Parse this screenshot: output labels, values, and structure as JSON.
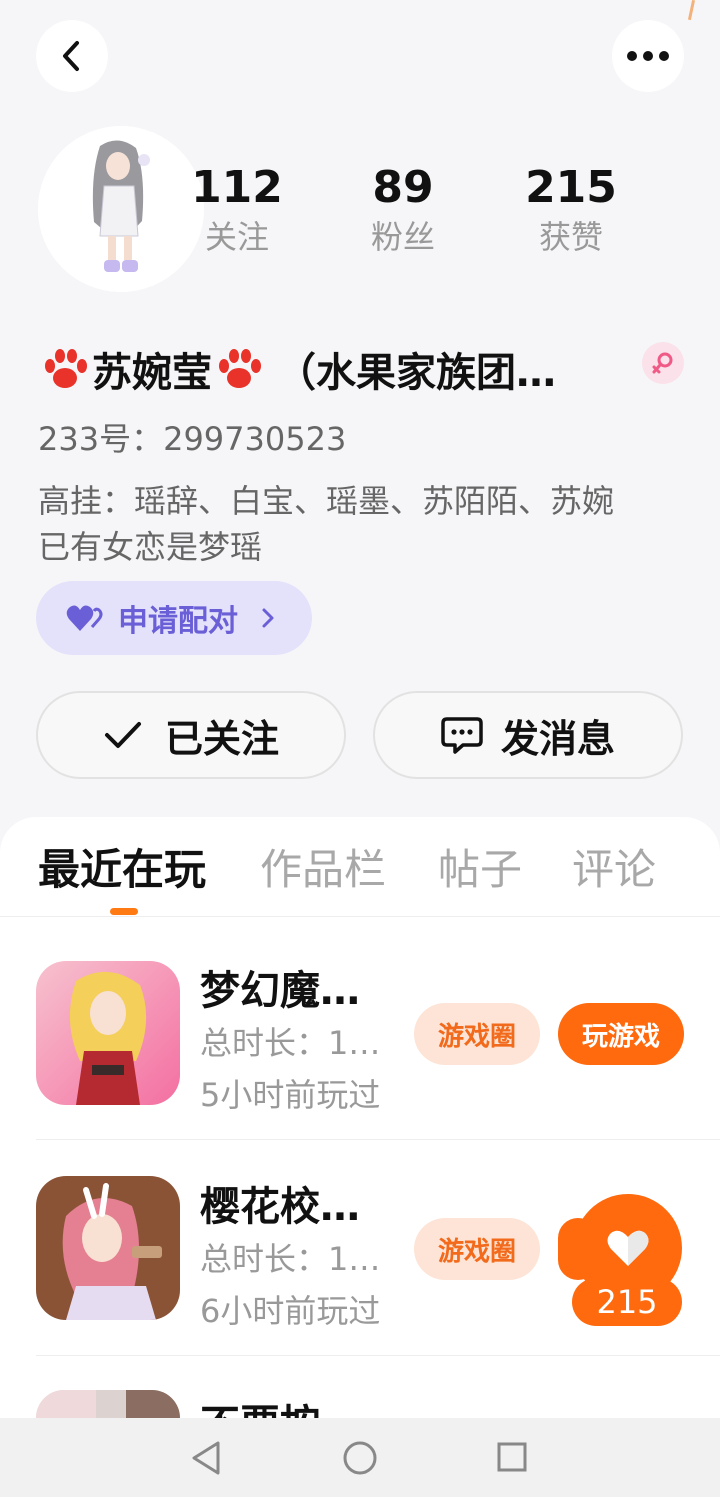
{
  "header": {
    "back_icon": "chevron-left-icon",
    "more_icon": "more-dots-icon"
  },
  "profile": {
    "stats": [
      {
        "value": "112",
        "label": "关注"
      },
      {
        "value": "89",
        "label": "粉丝"
      },
      {
        "value": "215",
        "label": "获赞"
      }
    ],
    "name": "苏婉莹",
    "name_suffix": "（水果家族团…",
    "gender_icon": "female-icon",
    "id_line": "233号：299730523",
    "bio_line1": "高挂：瑶辞、白宝、瑶墨、苏陌陌、苏婉",
    "bio_line2": "已有女恋是梦瑶",
    "pair_button": "申请配对",
    "follow_button": "已关注",
    "message_button": "发消息"
  },
  "tabs": [
    {
      "label": "最近在玩",
      "active": true
    },
    {
      "label": "作品栏",
      "active": false
    },
    {
      "label": "帖子",
      "active": false
    },
    {
      "label": "评论",
      "active": false
    }
  ],
  "games": [
    {
      "title": "梦幻魔…",
      "duration": "总时长：1…",
      "last_played": "5小时前玩过",
      "circle_label": "游戏圈",
      "play_label": "玩游戏"
    },
    {
      "title": "樱花校…",
      "duration": "总时长：1…",
      "last_played": "6小时前玩过",
      "circle_label": "游戏圈"
    },
    {
      "title": "不要按"
    }
  ],
  "like_float": {
    "count": "215",
    "icon": "heart-icon"
  },
  "colors": {
    "accent": "#ff6a0e",
    "pair": "#6a5fd6",
    "background": "#f6f6f8"
  }
}
